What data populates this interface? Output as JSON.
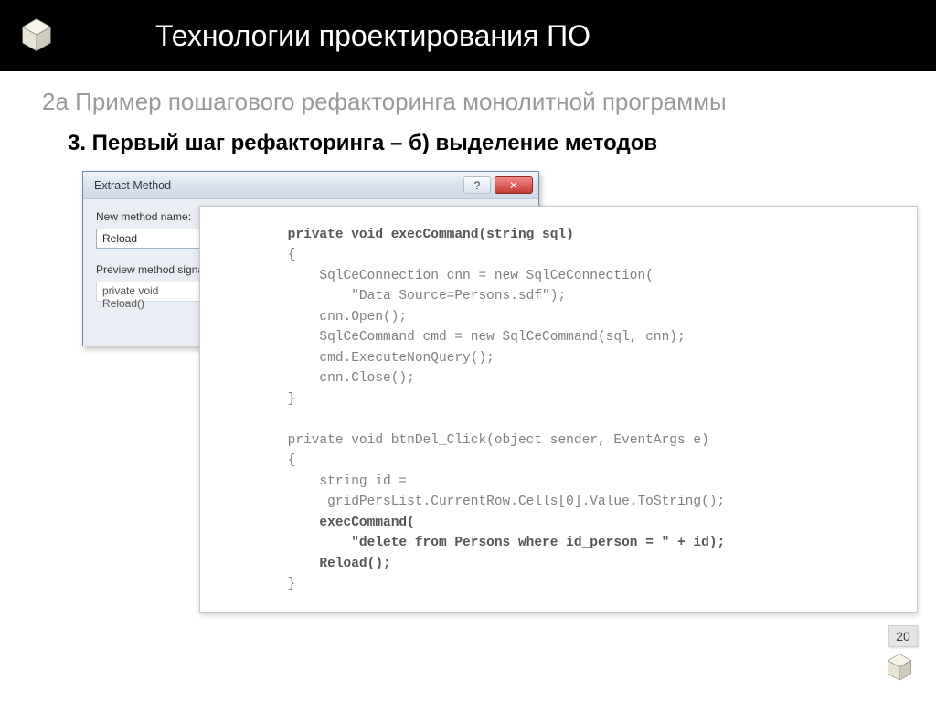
{
  "header": {
    "title": "Технологии проектирования ПО"
  },
  "subtitle": "2а Пример пошагового рефакторинга монолитной программы",
  "section_title": "3. Первый шаг рефакторинга – б) выделение методов",
  "dialog": {
    "title": "Extract Method",
    "help_glyph": "?",
    "close_glyph": "✕",
    "label_new_method": "New method name:",
    "label_new_method_u": "a",
    "input_value": "Reload",
    "label_preview": "Preview method signat",
    "label_preview_u": "P",
    "preview_value": "private void Reload()"
  },
  "code": {
    "l1": "        private void execCommand(string sql)",
    "l2": "        {",
    "l3": "            SqlCeConnection cnn = new SqlCeConnection(",
    "l4": "                \"Data Source=Persons.sdf\");",
    "l5": "            cnn.Open();",
    "l6": "            SqlCeCommand cmd = new SqlCeCommand(sql, cnn);",
    "l7": "            cmd.ExecuteNonQuery();",
    "l8": "            cnn.Close();",
    "l9": "        }",
    "l10": "",
    "l11": "        private void btnDel_Click(object sender, EventArgs e)",
    "l12": "        {",
    "l13": "            string id =",
    "l14": "             gridPersList.CurrentRow.Cells[0].Value.ToString();",
    "l15": "            execCommand(",
    "l16": "                \"delete from Persons where id_person = \" + id);",
    "l17": "            Reload();",
    "l18": "        }"
  },
  "page_number": "20"
}
